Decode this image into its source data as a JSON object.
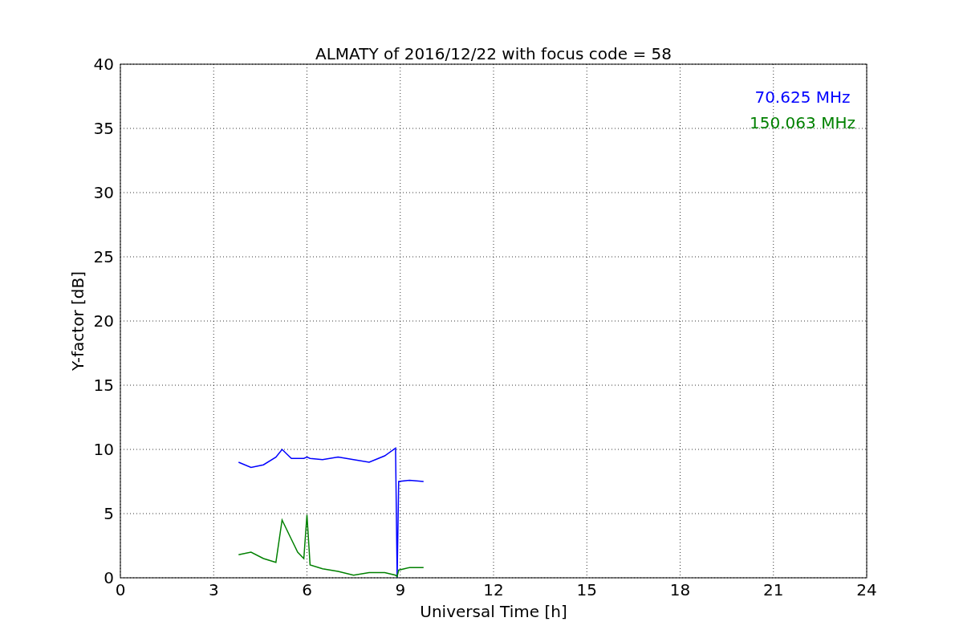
{
  "chart_data": {
    "type": "line",
    "title": "ALMATY of 2016/12/22 with focus code = 58",
    "xlabel": "Universal Time [h]",
    "ylabel": "Y-factor [dB]",
    "x": [
      3.8,
      4.2,
      4.6,
      5.0,
      5.2,
      5.5,
      5.7,
      5.9,
      6.0,
      6.1,
      6.5,
      7.0,
      7.5,
      8.0,
      8.5,
      8.85,
      8.9,
      8.95,
      9.3,
      9.75
    ],
    "series": [
      {
        "name": "70.625 MHz",
        "color": "#0000ff",
        "values": [
          9.0,
          8.6,
          8.8,
          9.4,
          10.0,
          9.3,
          9.3,
          9.3,
          9.4,
          9.3,
          9.2,
          9.4,
          9.2,
          9.0,
          9.5,
          10.1,
          0,
          7.5,
          7.6,
          7.5
        ]
      },
      {
        "name": "150.063 MHz",
        "color": "#008000",
        "values": [
          1.8,
          2.0,
          1.5,
          1.2,
          4.5,
          3.0,
          2.0,
          1.5,
          4.9,
          1.0,
          0.7,
          0.5,
          0.2,
          0.4,
          0.4,
          0.2,
          0.1,
          0.6,
          0.8,
          0.8
        ]
      }
    ],
    "xlim": [
      0,
      24
    ],
    "ylim": [
      0,
      40
    ],
    "xticks": [
      0,
      3,
      6,
      9,
      12,
      15,
      18,
      21,
      24
    ],
    "yticks": [
      0,
      5,
      10,
      15,
      20,
      25,
      30,
      35,
      40
    ],
    "grid": true
  }
}
